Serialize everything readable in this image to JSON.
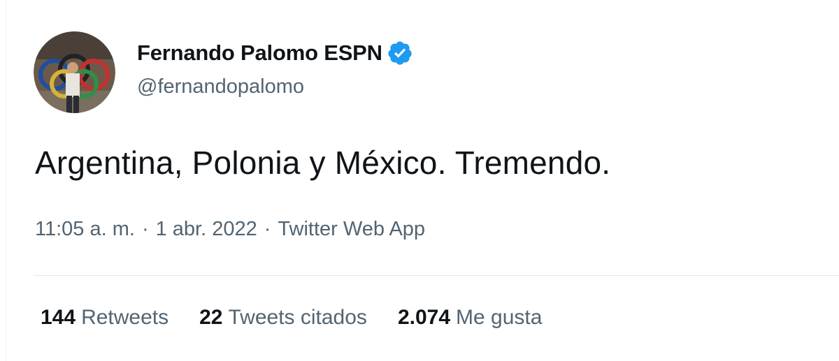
{
  "author": {
    "display_name": "Fernando Palomo ESPN",
    "handle": "@fernandopalomo",
    "verified": true,
    "avatar_icon": "profile-photo-olympic-rings",
    "verified_icon": "verified-badge-icon"
  },
  "tweet": {
    "text": "Argentina, Polonia y México. Tremendo."
  },
  "meta": {
    "time": "11:05 a. m.",
    "date": "1 abr. 2022",
    "source": "Twitter Web App",
    "separator": "·"
  },
  "stats": [
    {
      "count": "144",
      "label": "Retweets"
    },
    {
      "count": "22",
      "label": "Tweets citados"
    },
    {
      "count": "2.074",
      "label": "Me gusta"
    }
  ],
  "colors": {
    "primary_text": "#0f1419",
    "secondary_text": "#536471",
    "verified_blue": "#1d9bf0",
    "divider": "#e1e8ed"
  }
}
